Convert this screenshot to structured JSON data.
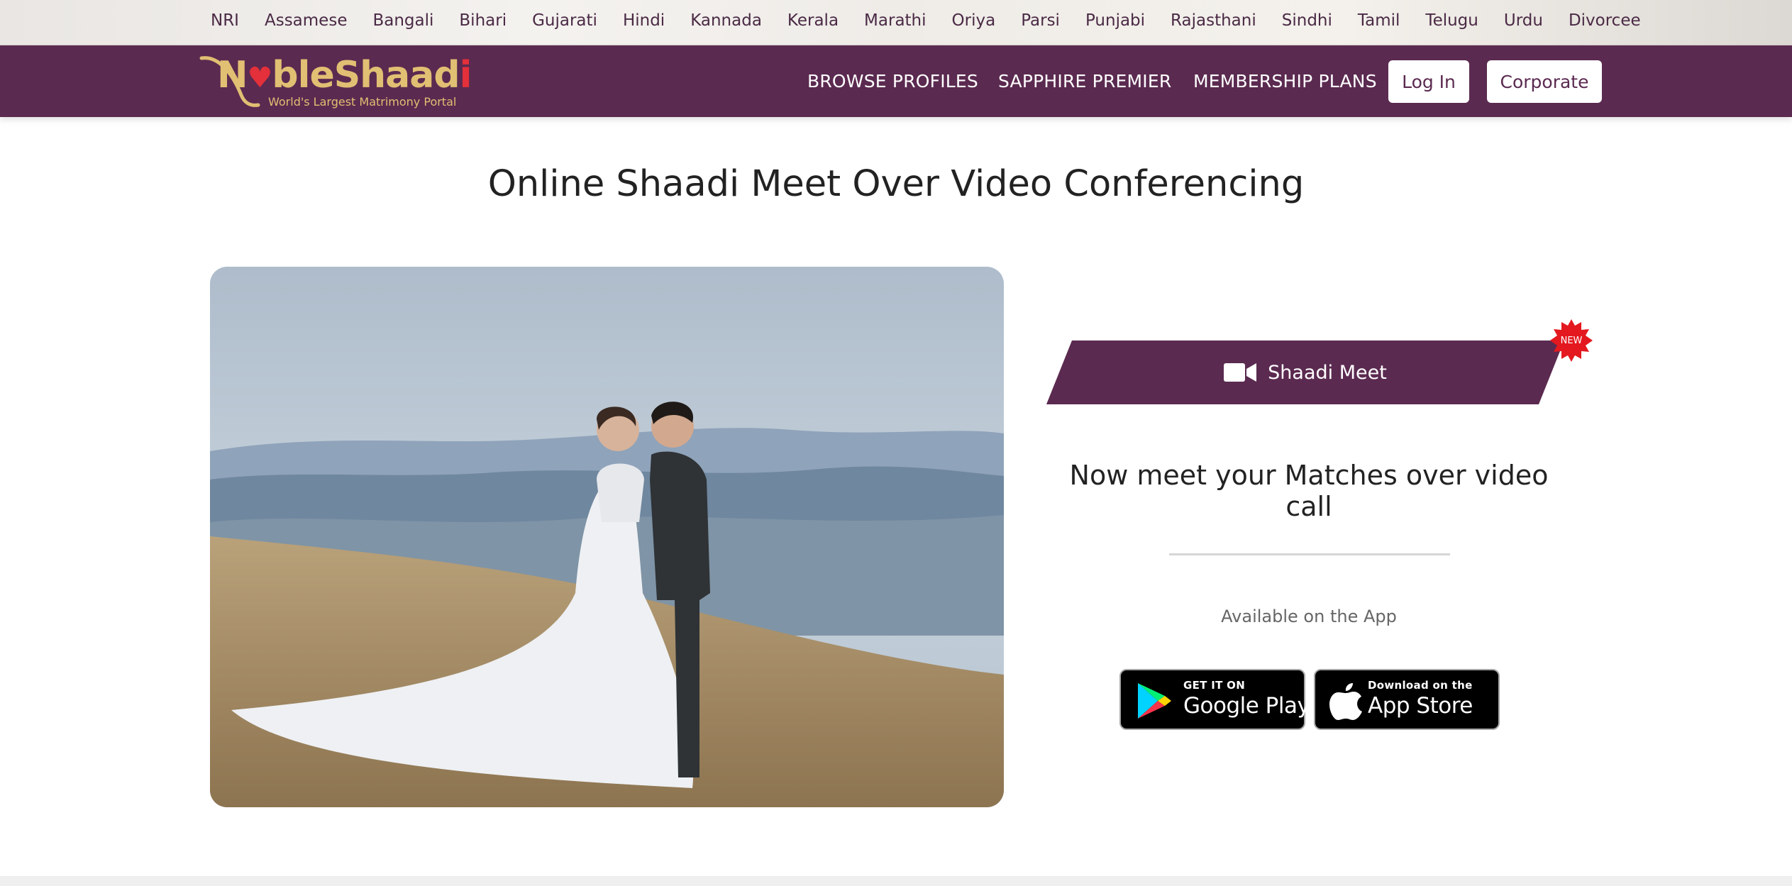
{
  "communities": [
    "NRI",
    "Assamese",
    "Bangali",
    "Bihari",
    "Gujarati",
    "Hindi",
    "Kannada",
    "Kerala",
    "Marathi",
    "Oriya",
    "Parsi",
    "Punjabi",
    "Rajasthani",
    "Sindhi",
    "Tamil",
    "Telugu",
    "Urdu",
    "Divorcee"
  ],
  "logo": {
    "brand": "NobleShaadi",
    "tagline": "World's Largest Matrimony Portal"
  },
  "nav": {
    "browse": "BROWSE PROFILES",
    "sapphire": "SAPPHIRE PREMIER",
    "membership": "MEMBERSHIP PLANS",
    "login": "Log In",
    "corporate": "Corporate"
  },
  "main": {
    "title": "Online Shaadi Meet Over Video Conferencing",
    "meet_label": "Shaadi Meet",
    "new_badge": "NEW",
    "subhead": "Now meet your Matches over video call",
    "available": "Available on the App"
  },
  "stores": {
    "google_small": "GET IT ON",
    "google_big": "Google Play",
    "apple_small": "Download on the",
    "apple_big": "App Store"
  },
  "colors": {
    "brand_purple": "#5b2a50",
    "logo_gold": "#e1bf73",
    "badge_red": "#e3191f"
  },
  "icons": [
    "video-camera-icon",
    "google-play-icon",
    "apple-icon",
    "heart-icon"
  ]
}
